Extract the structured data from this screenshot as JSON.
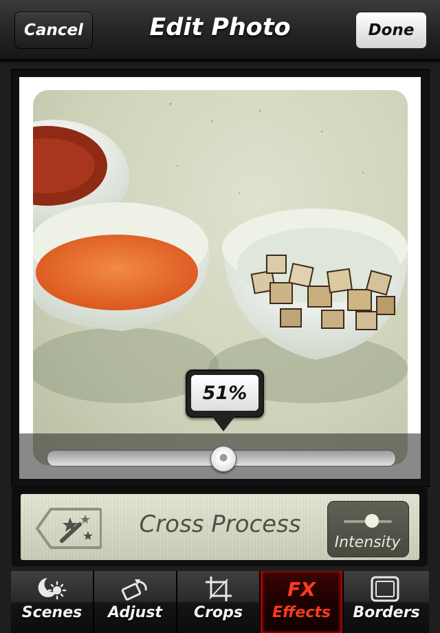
{
  "header": {
    "title": "Edit Photo",
    "cancel_label": "Cancel",
    "done_label": "Done"
  },
  "photo": {
    "intensity_value": "51%",
    "slider_fraction": 0.51
  },
  "effect_panel": {
    "effect_name": "Cross Process",
    "intensity_label": "Intensity",
    "tag_icon": "magic-wand-icon"
  },
  "tabs": [
    {
      "label": "Scenes",
      "icon": "scenes-icon"
    },
    {
      "label": "Adjust",
      "icon": "adjust-icon"
    },
    {
      "label": "Crops",
      "icon": "crop-icon"
    },
    {
      "label": "Effects",
      "icon": "fx-icon",
      "icon_text": "FX",
      "active": true
    },
    {
      "label": "Borders",
      "icon": "borders-icon"
    }
  ],
  "colors": {
    "active_tab_red": "#ff3b1f",
    "panel_bg": "#d6dac4"
  }
}
